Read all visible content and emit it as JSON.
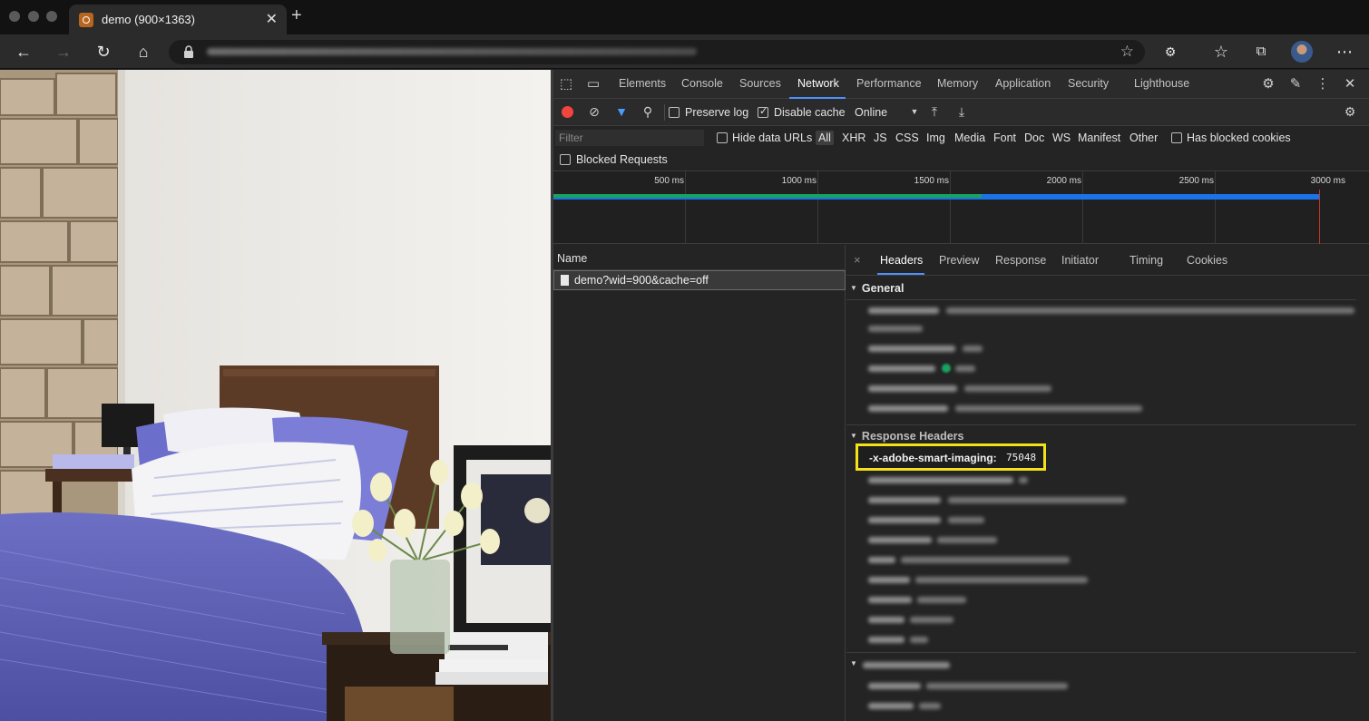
{
  "browser": {
    "tab_title": "demo (900×1363)",
    "tab_close": "✕",
    "new_tab": "+",
    "address_blurred": true
  },
  "devtools": {
    "tabs": [
      "Elements",
      "Console",
      "Sources",
      "Network",
      "Performance",
      "Memory",
      "Application",
      "Security",
      "Lighthouse"
    ],
    "active_tab": "Network",
    "network_toolbar": {
      "preserve_log_label": "Preserve log",
      "preserve_log_checked": false,
      "disable_cache_label": "Disable cache",
      "disable_cache_checked": true,
      "throttling_value": "Online"
    },
    "filter": {
      "placeholder": "Filter",
      "hide_data_urls_label": "Hide data URLs",
      "types": [
        "All",
        "XHR",
        "JS",
        "CSS",
        "Img",
        "Media",
        "Font",
        "Doc",
        "WS",
        "Manifest",
        "Other"
      ],
      "active_type": "All",
      "has_blocked_cookies_label": "Has blocked cookies",
      "blocked_requests_label": "Blocked Requests"
    },
    "overview_ticks": [
      "500 ms",
      "1000 ms",
      "1500 ms",
      "2000 ms",
      "2500 ms",
      "3000 ms"
    ],
    "requests": {
      "column_name": "Name",
      "rows": [
        "demo?wid=900&cache=off"
      ]
    },
    "details": {
      "close": "×",
      "tabs": [
        "Headers",
        "Preview",
        "Response",
        "Initiator",
        "Timing",
        "Cookies"
      ],
      "active_tab": "Headers",
      "general_title": "General",
      "response_headers_title": "Response Headers",
      "highlighted_header_name": "-x-adobe-smart-imaging:",
      "highlighted_header_value": "75048"
    }
  },
  "colors": {
    "record": "#f2453d",
    "accent": "#4d90fe",
    "highlight_border": "#f5e11a",
    "waterfall_green": "#1aa260",
    "waterfall_blue": "#1a73e8"
  }
}
